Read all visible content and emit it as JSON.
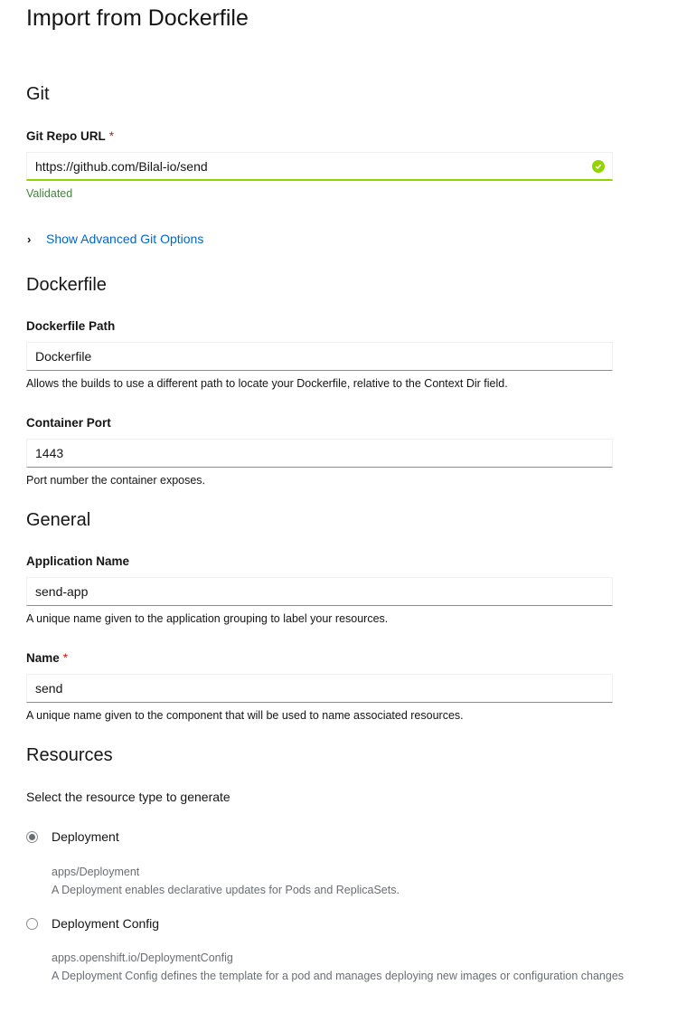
{
  "page": {
    "title": "Import from Dockerfile"
  },
  "git": {
    "section_title": "Git",
    "repo_url": {
      "label": "Git Repo URL",
      "required_marker": "*",
      "value": "https://github.com/Bilal-io/send",
      "status_icon": "check-circle-icon",
      "helper": "Validated"
    },
    "advanced_toggle": {
      "icon": "chevron-right-icon",
      "label": "Show Advanced Git Options"
    }
  },
  "dockerfile": {
    "section_title": "Dockerfile",
    "path": {
      "label": "Dockerfile Path",
      "value": "Dockerfile",
      "helper": "Allows the builds to use a different path to locate your Dockerfile, relative to the Context Dir field."
    },
    "port": {
      "label": "Container Port",
      "value": "1443",
      "helper": "Port number the container exposes."
    }
  },
  "general": {
    "section_title": "General",
    "application_name": {
      "label": "Application Name",
      "value": "send-app",
      "helper": "A unique name given to the application grouping to label your resources."
    },
    "name": {
      "label": "Name",
      "required_marker": "*",
      "value": "send",
      "helper": "A unique name given to the component that will be used to name associated resources."
    }
  },
  "resources": {
    "section_title": "Resources",
    "prompt": "Select the resource type to generate",
    "options": [
      {
        "label": "Deployment",
        "selected": true,
        "api": "apps/Deployment",
        "description": "A Deployment enables declarative updates for Pods and ReplicaSets."
      },
      {
        "label": "Deployment Config",
        "selected": false,
        "api": "apps.openshift.io/DeploymentConfig",
        "description": "A Deployment Config defines the template for a pod and manages deploying new images or configuration changes"
      }
    ]
  },
  "colors": {
    "success": "#92d400",
    "link": "#0066cc",
    "required": "#c9190b",
    "muted": "#6a6e73"
  }
}
